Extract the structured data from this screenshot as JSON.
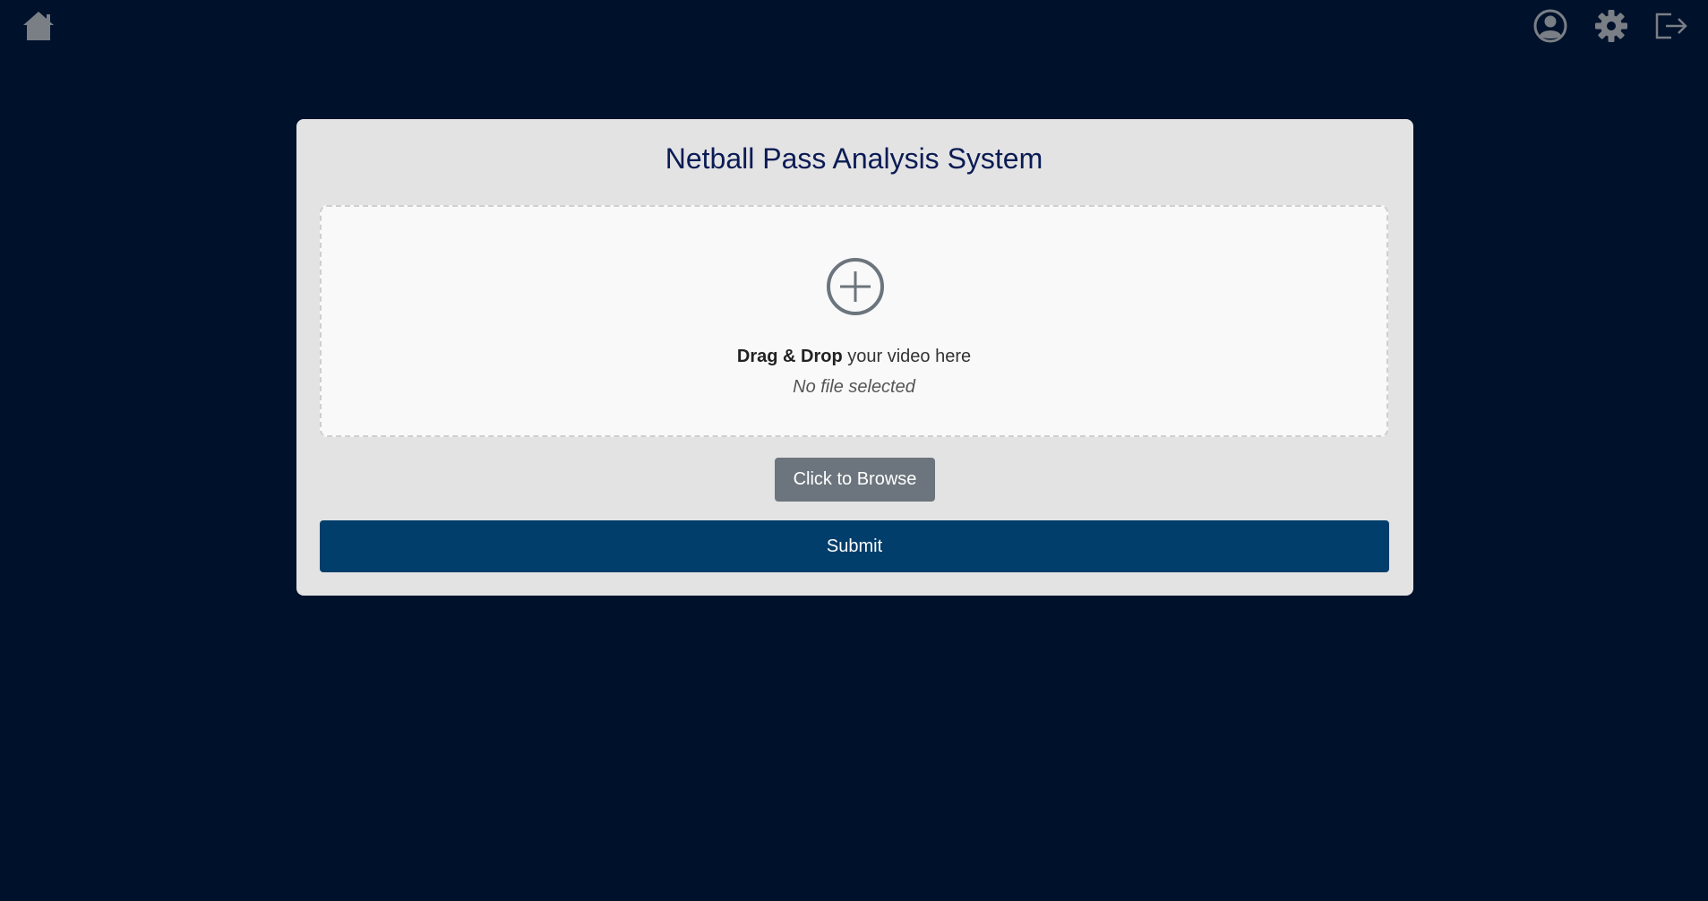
{
  "topbar": {
    "icons": {
      "home": "home-icon",
      "profile": "user-circle-icon",
      "settings": "gear-icon",
      "logout": "logout-icon"
    },
    "icon_color": "#7a7f86"
  },
  "card": {
    "title": "Netball Pass Analysis System",
    "dropzone": {
      "icon": "plus-circle-icon",
      "bold_text": "Drag & Drop",
      "text": " your video here",
      "file_status": "No file selected"
    },
    "browse_label": "Click to Browse",
    "submit_label": "Submit"
  },
  "colors": {
    "background": "#00112b",
    "card": "#e3e3e3",
    "title": "#0b1b55",
    "browse_button": "#6c757d",
    "submit_button": "#023e6b"
  }
}
